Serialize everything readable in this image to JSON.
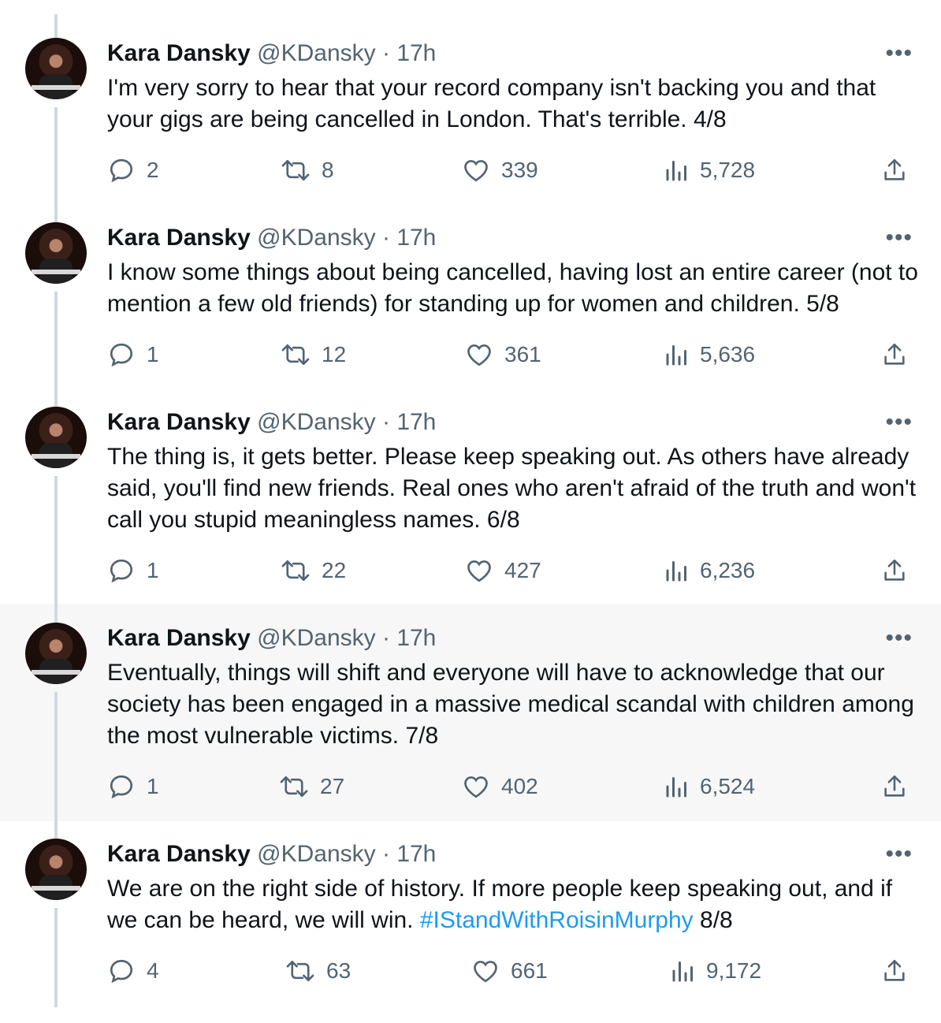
{
  "tweets": [
    {
      "name": "Kara Dansky",
      "handle": "@KDansky",
      "separator": "·",
      "time": "17h",
      "more": "•••",
      "text": "I'm very sorry to hear that your record company isn't backing you and that your gigs are being cancelled in London. That's terrible. 4/8",
      "hashtag": "",
      "suffix": "",
      "replies": "2",
      "retweets": "8",
      "likes": "339",
      "views": "5,728"
    },
    {
      "name": "Kara Dansky",
      "handle": "@KDansky",
      "separator": "·",
      "time": "17h",
      "more": "•••",
      "text": "I know some things about being cancelled, having lost an entire career (not to mention a few old friends) for standing up for women and children. 5/8",
      "hashtag": "",
      "suffix": "",
      "replies": "1",
      "retweets": "12",
      "likes": "361",
      "views": "5,636"
    },
    {
      "name": "Kara Dansky",
      "handle": "@KDansky",
      "separator": "·",
      "time": "17h",
      "more": "•••",
      "text": "The thing is, it gets better. Please keep speaking out. As others have already said, you'll find new friends. Real ones who aren't afraid of the truth and won't call you stupid meaningless names. 6/8",
      "hashtag": "",
      "suffix": "",
      "replies": "1",
      "retweets": "22",
      "likes": "427",
      "views": "6,236"
    },
    {
      "name": "Kara Dansky",
      "handle": "@KDansky",
      "separator": "·",
      "time": "17h",
      "more": "•••",
      "text": "Eventually, things will shift and everyone will have to acknowledge that our society has been engaged in a massive medical scandal with children among the most vulnerable victims. 7/8",
      "hashtag": "",
      "suffix": "",
      "replies": "1",
      "retweets": "27",
      "likes": "402",
      "views": "6,524"
    },
    {
      "name": "Kara Dansky",
      "handle": "@KDansky",
      "separator": "·",
      "time": "17h",
      "more": "•••",
      "text": "We are on the right side of history. If more people keep speaking out, and if we can be heard, we will win. ",
      "hashtag": "#IStandWithRoisinMurphy",
      "suffix": " 8/8",
      "replies": "4",
      "retweets": "63",
      "likes": "661",
      "views": "9,172"
    }
  ],
  "icons": {
    "reply": "reply-icon",
    "retweet": "retweet-icon",
    "like": "heart-icon",
    "views": "views-icon",
    "share": "share-icon",
    "more": "more-icon"
  },
  "colors": {
    "text": "#0f1419",
    "secondary": "#536471",
    "link": "#1d9bf0",
    "thread_line": "#cfd9de",
    "highlight_bg": "#f7f7f7"
  }
}
